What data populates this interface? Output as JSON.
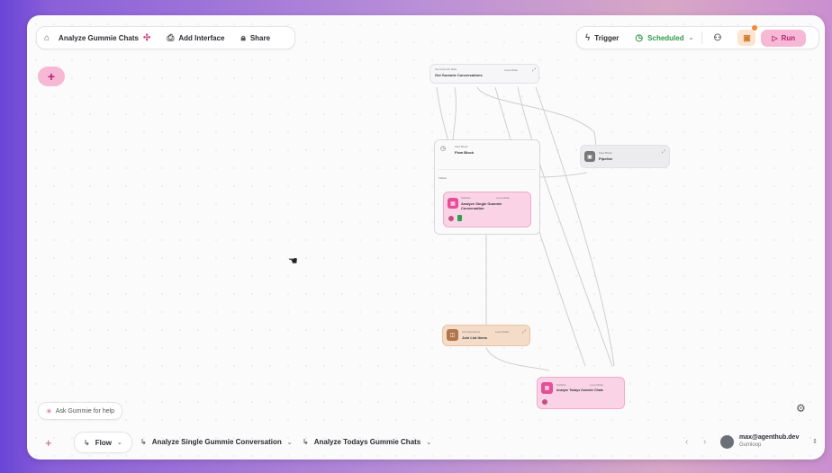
{
  "toolbar": {
    "workflow_title": "Analyze Gummie Chats",
    "add_interface": "Add Interface",
    "share": "Share",
    "trigger": "Trigger",
    "scheduled": "Scheduled",
    "run": "Run"
  },
  "canvas": {
    "ask_gummie": "Ask Gummie for help",
    "nodes": {
      "get_convos": {
        "type": "Get Gummie Data",
        "title": "Get Gummie Conversations",
        "loop_mode": "Loop Mode"
      },
      "for_loop": {
        "type": "Flow Block",
        "title": "Flow Block",
        "mode_label": "Flatten",
        "loop_mode": "Loop Mode"
      },
      "analyze_single": {
        "type": "Subflow",
        "title": "Analyze Single Gummie Conversation",
        "loop_mode": "Loop Mode"
      },
      "pipeline": {
        "type": "Flow Block",
        "title": "Pipeline"
      },
      "list_ops": {
        "type": "List Operations",
        "title": "Join List Items",
        "loop_mode": "Loop Mode"
      },
      "analyze_todays": {
        "type": "Subflow",
        "title": "Analyze Todays Gummie Chats",
        "loop_mode": "Loop Mode"
      }
    }
  },
  "bottom": {
    "flow": "Flow",
    "tab1": "Analyze Single Gummie Conversation",
    "tab2": "Analyze Todays Gummie Chats",
    "user_email": "max@agenthub.dev",
    "org": "Gumloop"
  },
  "colors": {
    "accent_pink": "#f7b8d6",
    "accent_text": "#b32370",
    "scheduled_green": "#2f9a4d"
  }
}
